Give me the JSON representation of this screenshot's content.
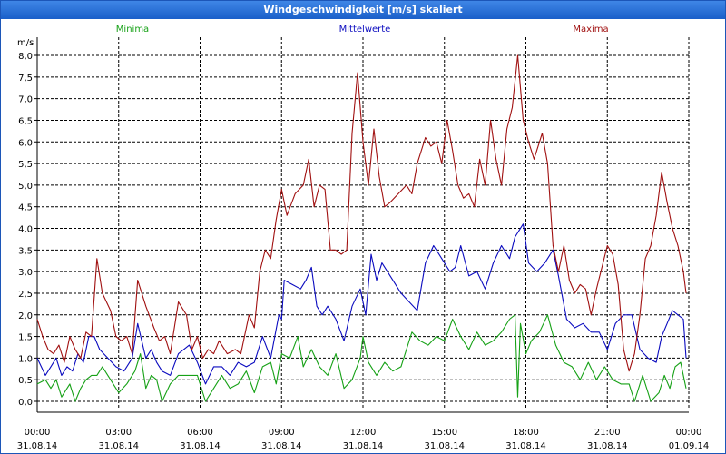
{
  "window": {
    "title": "Windgeschwindigkeit [m/s] skaliert"
  },
  "colors": {
    "Minima": "#16a116",
    "Mittelwerte": "#0b0bbf",
    "Maxima": "#a01010",
    "title_bar": "#1f63d0"
  },
  "chart_data": {
    "type": "line",
    "title": "Windgeschwindigkeit [m/s] skaliert",
    "ylabel": "m/s",
    "ylim": [
      0,
      8
    ],
    "y_ticks": [
      "0,0",
      "0,5",
      "1,0",
      "1,5",
      "2,0",
      "2,5",
      "3,0",
      "3,5",
      "4,0",
      "4,5",
      "5,0",
      "5,5",
      "6,0",
      "6,5",
      "7,0",
      "7,5",
      "8,0"
    ],
    "x_range_hours": [
      0,
      24
    ],
    "x_ticks": [
      {
        "time": "00:00",
        "date": "31.08.14"
      },
      {
        "time": "03:00",
        "date": "31.08.14"
      },
      {
        "time": "06:00",
        "date": "31.08.14"
      },
      {
        "time": "09:00",
        "date": "31.08.14"
      },
      {
        "time": "12:00",
        "date": "31.08.14"
      },
      {
        "time": "15:00",
        "date": "31.08.14"
      },
      {
        "time": "18:00",
        "date": "31.08.14"
      },
      {
        "time": "21:00",
        "date": "31.08.14"
      },
      {
        "time": "00:00",
        "date": "01.09.14"
      }
    ],
    "grid": true,
    "legend": "top",
    "series": [
      {
        "name": "Minima",
        "values": [
          [
            0,
            0.4
          ],
          [
            0.3,
            0.5
          ],
          [
            0.5,
            0.3
          ],
          [
            0.7,
            0.5
          ],
          [
            0.9,
            0.1
          ],
          [
            1.2,
            0.4
          ],
          [
            1.4,
            0
          ],
          [
            1.6,
            0.3
          ],
          [
            1.8,
            0.5
          ],
          [
            2.0,
            0.6
          ],
          [
            2.2,
            0.6
          ],
          [
            2.4,
            0.8
          ],
          [
            2.7,
            0.5
          ],
          [
            3.0,
            0.2
          ],
          [
            3.3,
            0.4
          ],
          [
            3.6,
            0.7
          ],
          [
            3.8,
            1.1
          ],
          [
            4.0,
            0.3
          ],
          [
            4.2,
            0.6
          ],
          [
            4.4,
            0.5
          ],
          [
            4.6,
            0
          ],
          [
            4.9,
            0.4
          ],
          [
            5.2,
            0.6
          ],
          [
            5.6,
            0.6
          ],
          [
            5.9,
            0.6
          ],
          [
            6.2,
            0
          ],
          [
            6.5,
            0.3
          ],
          [
            6.8,
            0.6
          ],
          [
            7.1,
            0.3
          ],
          [
            7.4,
            0.4
          ],
          [
            7.7,
            0.7
          ],
          [
            8.0,
            0.2
          ],
          [
            8.3,
            0.8
          ],
          [
            8.6,
            0.9
          ],
          [
            8.8,
            0.4
          ],
          [
            9.0,
            1.1
          ],
          [
            9.3,
            1.0
          ],
          [
            9.6,
            1.5
          ],
          [
            9.8,
            0.8
          ],
          [
            10.1,
            1.2
          ],
          [
            10.4,
            0.8
          ],
          [
            10.7,
            0.6
          ],
          [
            11.0,
            1.1
          ],
          [
            11.3,
            0.3
          ],
          [
            11.6,
            0.5
          ],
          [
            11.9,
            1.0
          ],
          [
            12.0,
            1.5
          ],
          [
            12.2,
            0.9
          ],
          [
            12.5,
            0.6
          ],
          [
            12.8,
            0.9
          ],
          [
            13.1,
            0.7
          ],
          [
            13.4,
            0.8
          ],
          [
            13.8,
            1.6
          ],
          [
            14.1,
            1.4
          ],
          [
            14.4,
            1.3
          ],
          [
            14.7,
            1.5
          ],
          [
            15.0,
            1.4
          ],
          [
            15.3,
            1.9
          ],
          [
            15.6,
            1.5
          ],
          [
            15.9,
            1.2
          ],
          [
            16.2,
            1.6
          ],
          [
            16.5,
            1.3
          ],
          [
            16.8,
            1.4
          ],
          [
            17.1,
            1.6
          ],
          [
            17.4,
            1.9
          ],
          [
            17.6,
            2.0
          ],
          [
            17.7,
            0.1
          ],
          [
            17.8,
            1.8
          ],
          [
            18.0,
            1.1
          ],
          [
            18.2,
            1.4
          ],
          [
            18.5,
            1.6
          ],
          [
            18.8,
            2.0
          ],
          [
            19.1,
            1.3
          ],
          [
            19.4,
            0.9
          ],
          [
            19.7,
            0.8
          ],
          [
            20.0,
            0.5
          ],
          [
            20.3,
            0.9
          ],
          [
            20.6,
            0.5
          ],
          [
            20.9,
            0.8
          ],
          [
            21.2,
            0.5
          ],
          [
            21.5,
            0.4
          ],
          [
            21.8,
            0.4
          ],
          [
            22.0,
            0
          ],
          [
            22.3,
            0.6
          ],
          [
            22.6,
            0
          ],
          [
            22.9,
            0.2
          ],
          [
            23.1,
            0.6
          ],
          [
            23.3,
            0.3
          ],
          [
            23.5,
            0.8
          ],
          [
            23.7,
            0.9
          ],
          [
            23.9,
            0.3
          ]
        ]
      },
      {
        "name": "Mittelwerte",
        "values": [
          [
            0,
            1.0
          ],
          [
            0.3,
            0.6
          ],
          [
            0.5,
            0.8
          ],
          [
            0.7,
            1.0
          ],
          [
            0.9,
            0.6
          ],
          [
            1.1,
            0.8
          ],
          [
            1.3,
            0.7
          ],
          [
            1.5,
            1.1
          ],
          [
            1.7,
            0.9
          ],
          [
            1.9,
            1.5
          ],
          [
            2.1,
            1.5
          ],
          [
            2.3,
            1.2
          ],
          [
            2.6,
            1.0
          ],
          [
            2.9,
            0.8
          ],
          [
            3.2,
            0.7
          ],
          [
            3.5,
            1.0
          ],
          [
            3.7,
            1.8
          ],
          [
            4.0,
            1.0
          ],
          [
            4.2,
            1.2
          ],
          [
            4.4,
            0.9
          ],
          [
            4.6,
            0.7
          ],
          [
            4.9,
            0.6
          ],
          [
            5.2,
            1.1
          ],
          [
            5.6,
            1.3
          ],
          [
            5.9,
            0.9
          ],
          [
            6.2,
            0.4
          ],
          [
            6.5,
            0.8
          ],
          [
            6.8,
            0.8
          ],
          [
            7.1,
            0.6
          ],
          [
            7.4,
            0.9
          ],
          [
            7.7,
            0.8
          ],
          [
            8.0,
            0.9
          ],
          [
            8.3,
            1.5
          ],
          [
            8.6,
            1.0
          ],
          [
            8.9,
            2.0
          ],
          [
            9.0,
            1.9
          ],
          [
            9.1,
            2.8
          ],
          [
            9.4,
            2.7
          ],
          [
            9.7,
            2.6
          ],
          [
            9.9,
            2.8
          ],
          [
            10.1,
            3.1
          ],
          [
            10.3,
            2.2
          ],
          [
            10.5,
            2.0
          ],
          [
            10.7,
            2.2
          ],
          [
            11.0,
            1.9
          ],
          [
            11.3,
            1.4
          ],
          [
            11.6,
            2.2
          ],
          [
            11.9,
            2.6
          ],
          [
            12.1,
            2.0
          ],
          [
            12.3,
            3.4
          ],
          [
            12.5,
            2.8
          ],
          [
            12.7,
            3.2
          ],
          [
            12.9,
            3.0
          ],
          [
            13.1,
            2.8
          ],
          [
            13.4,
            2.5
          ],
          [
            13.7,
            2.3
          ],
          [
            14.0,
            2.1
          ],
          [
            14.3,
            3.2
          ],
          [
            14.6,
            3.6
          ],
          [
            14.9,
            3.3
          ],
          [
            15.2,
            3.0
          ],
          [
            15.4,
            3.1
          ],
          [
            15.6,
            3.6
          ],
          [
            15.9,
            2.9
          ],
          [
            16.2,
            3.0
          ],
          [
            16.5,
            2.6
          ],
          [
            16.8,
            3.2
          ],
          [
            17.1,
            3.6
          ],
          [
            17.4,
            3.3
          ],
          [
            17.6,
            3.8
          ],
          [
            17.9,
            4.1
          ],
          [
            18.1,
            3.2
          ],
          [
            18.4,
            3.0
          ],
          [
            18.7,
            3.2
          ],
          [
            19.0,
            3.5
          ],
          [
            19.2,
            2.9
          ],
          [
            19.5,
            1.9
          ],
          [
            19.8,
            1.7
          ],
          [
            20.1,
            1.8
          ],
          [
            20.4,
            1.6
          ],
          [
            20.7,
            1.6
          ],
          [
            21.0,
            1.2
          ],
          [
            21.3,
            1.8
          ],
          [
            21.6,
            2.0
          ],
          [
            21.9,
            2.0
          ],
          [
            22.2,
            1.2
          ],
          [
            22.5,
            1.0
          ],
          [
            22.8,
            0.9
          ],
          [
            23.0,
            1.5
          ],
          [
            23.2,
            1.8
          ],
          [
            23.4,
            2.1
          ],
          [
            23.6,
            2.0
          ],
          [
            23.8,
            1.9
          ],
          [
            23.9,
            1.0
          ]
        ]
      },
      {
        "name": "Maxima",
        "values": [
          [
            0,
            1.9
          ],
          [
            0.2,
            1.5
          ],
          [
            0.4,
            1.2
          ],
          [
            0.6,
            1.1
          ],
          [
            0.8,
            1.3
          ],
          [
            1.0,
            0.9
          ],
          [
            1.2,
            1.5
          ],
          [
            1.4,
            1.2
          ],
          [
            1.6,
            1.0
          ],
          [
            1.8,
            1.6
          ],
          [
            2.0,
            1.5
          ],
          [
            2.2,
            3.3
          ],
          [
            2.4,
            2.5
          ],
          [
            2.7,
            2.1
          ],
          [
            2.9,
            1.5
          ],
          [
            3.1,
            1.4
          ],
          [
            3.3,
            1.5
          ],
          [
            3.5,
            1.1
          ],
          [
            3.7,
            2.8
          ],
          [
            4.0,
            2.2
          ],
          [
            4.3,
            1.7
          ],
          [
            4.5,
            1.4
          ],
          [
            4.7,
            1.5
          ],
          [
            4.9,
            1.1
          ],
          [
            5.2,
            2.3
          ],
          [
            5.5,
            2.0
          ],
          [
            5.7,
            1.2
          ],
          [
            5.9,
            1.5
          ],
          [
            6.1,
            1.0
          ],
          [
            6.3,
            1.2
          ],
          [
            6.5,
            1.1
          ],
          [
            6.7,
            1.4
          ],
          [
            7.0,
            1.1
          ],
          [
            7.3,
            1.2
          ],
          [
            7.5,
            1.1
          ],
          [
            7.8,
            2.0
          ],
          [
            8.0,
            1.7
          ],
          [
            8.2,
            3.0
          ],
          [
            8.4,
            3.5
          ],
          [
            8.6,
            3.3
          ],
          [
            8.8,
            4.2
          ],
          [
            9.0,
            4.9
          ],
          [
            9.2,
            4.3
          ],
          [
            9.5,
            4.8
          ],
          [
            9.8,
            5.0
          ],
          [
            10.0,
            5.6
          ],
          [
            10.2,
            4.5
          ],
          [
            10.4,
            5.0
          ],
          [
            10.6,
            4.9
          ],
          [
            10.8,
            3.5
          ],
          [
            11.0,
            3.5
          ],
          [
            11.2,
            3.4
          ],
          [
            11.4,
            3.5
          ],
          [
            11.6,
            6.2
          ],
          [
            11.8,
            7.6
          ],
          [
            12.0,
            6.0
          ],
          [
            12.2,
            5.0
          ],
          [
            12.4,
            6.3
          ],
          [
            12.6,
            5.2
          ],
          [
            12.8,
            4.5
          ],
          [
            13.0,
            4.6
          ],
          [
            13.3,
            4.8
          ],
          [
            13.6,
            5.0
          ],
          [
            13.8,
            4.8
          ],
          [
            14.0,
            5.5
          ],
          [
            14.3,
            6.1
          ],
          [
            14.5,
            5.9
          ],
          [
            14.7,
            6.0
          ],
          [
            14.9,
            5.5
          ],
          [
            15.1,
            6.5
          ],
          [
            15.3,
            5.8
          ],
          [
            15.5,
            5.0
          ],
          [
            15.7,
            4.7
          ],
          [
            15.9,
            4.8
          ],
          [
            16.1,
            4.5
          ],
          [
            16.3,
            5.6
          ],
          [
            16.5,
            5.0
          ],
          [
            16.7,
            6.5
          ],
          [
            16.9,
            5.6
          ],
          [
            17.1,
            5.0
          ],
          [
            17.3,
            6.3
          ],
          [
            17.5,
            6.8
          ],
          [
            17.7,
            8.0
          ],
          [
            17.9,
            6.5
          ],
          [
            18.1,
            6.0
          ],
          [
            18.3,
            5.6
          ],
          [
            18.6,
            6.2
          ],
          [
            18.8,
            5.5
          ],
          [
            19.0,
            3.6
          ],
          [
            19.2,
            3.0
          ],
          [
            19.4,
            3.6
          ],
          [
            19.6,
            2.8
          ],
          [
            19.8,
            2.5
          ],
          [
            20.0,
            2.7
          ],
          [
            20.2,
            2.6
          ],
          [
            20.4,
            2.0
          ],
          [
            20.6,
            2.6
          ],
          [
            20.8,
            3.1
          ],
          [
            21.0,
            3.6
          ],
          [
            21.2,
            3.4
          ],
          [
            21.4,
            2.7
          ],
          [
            21.6,
            1.2
          ],
          [
            21.8,
            0.7
          ],
          [
            22.0,
            1.1
          ],
          [
            22.2,
            2.0
          ],
          [
            22.4,
            3.3
          ],
          [
            22.6,
            3.6
          ],
          [
            22.8,
            4.3
          ],
          [
            23.0,
            5.3
          ],
          [
            23.2,
            4.6
          ],
          [
            23.4,
            4.0
          ],
          [
            23.6,
            3.6
          ],
          [
            23.8,
            3.0
          ],
          [
            23.9,
            2.5
          ]
        ]
      }
    ]
  }
}
